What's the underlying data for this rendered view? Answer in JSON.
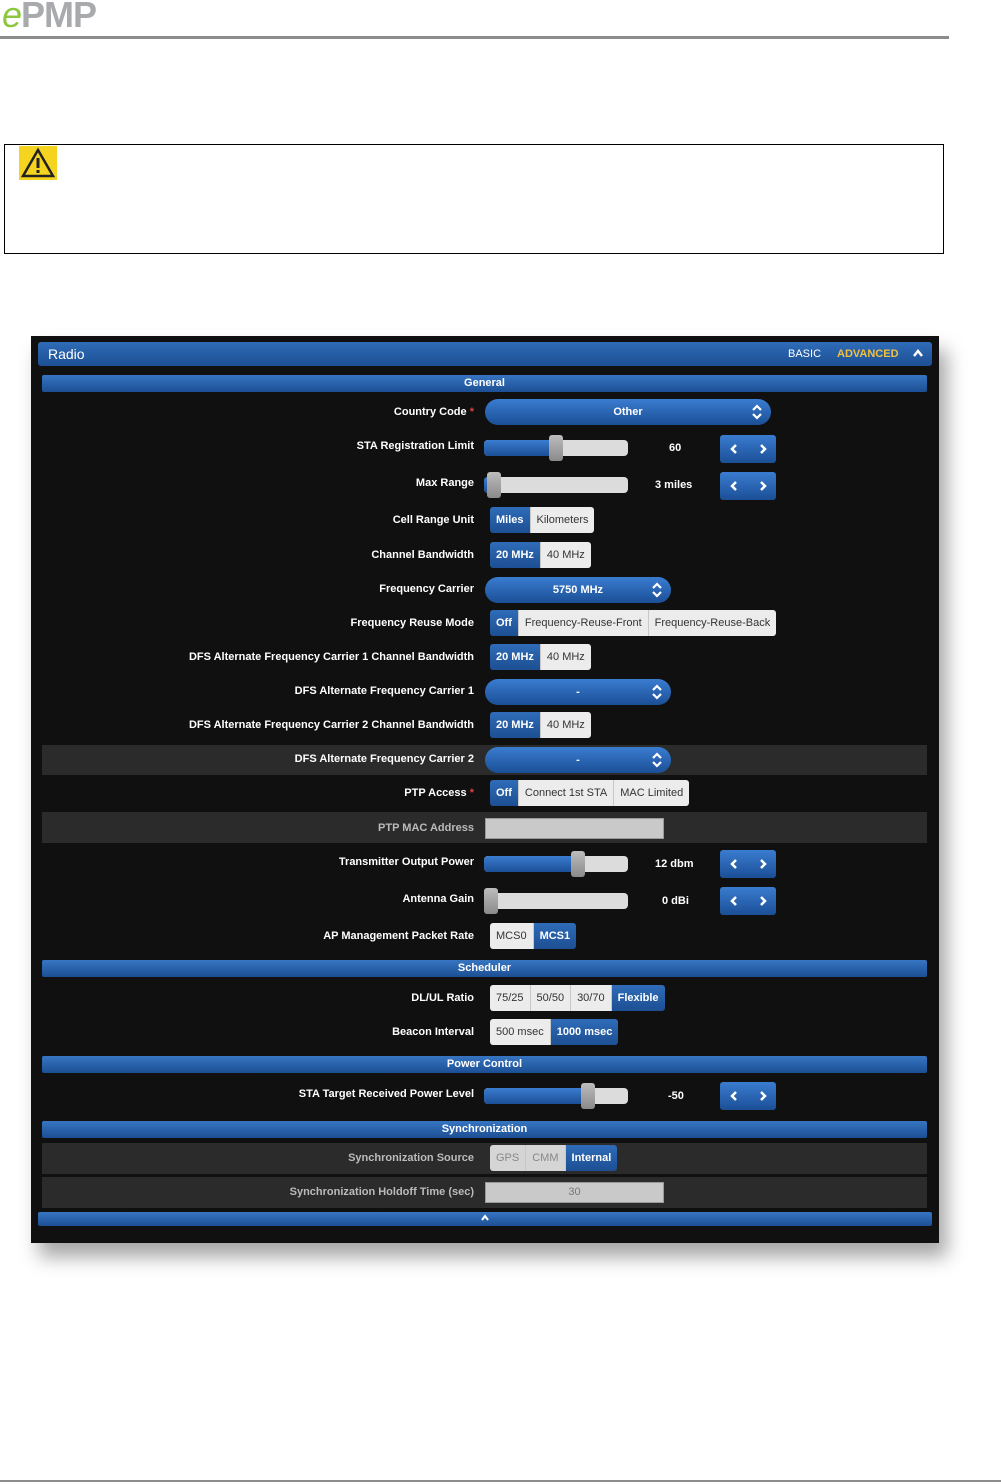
{
  "logo": {
    "prefix": "e",
    "name": "PMP"
  },
  "panel": {
    "title": "Radio",
    "mode_basic": "BASIC",
    "mode_advanced": "ADVANCED",
    "sections": {
      "general": "General",
      "scheduler": "Scheduler",
      "power": "Power Control",
      "sync": "Synchronization"
    },
    "country_code": {
      "label": "Country Code",
      "req": "*",
      "value": "Other"
    },
    "sta_limit": {
      "label": "STA Registration Limit",
      "value": "60",
      "level": 0.5
    },
    "max_range": {
      "label": "Max Range",
      "value": "3 miles",
      "level": 0.07
    },
    "cell_range_unit": {
      "label": "Cell Range Unit",
      "options": [
        "Miles",
        "Kilometers"
      ],
      "selected": "Miles"
    },
    "channel_bw": {
      "label": "Channel Bandwidth",
      "options": [
        "20 MHz",
        "40 MHz"
      ],
      "selected": "20 MHz"
    },
    "freq_carrier": {
      "label": "Frequency Carrier",
      "value": "5750 MHz"
    },
    "freq_reuse": {
      "label": "Frequency Reuse Mode",
      "options": [
        "Off",
        "Frequency-Reuse-Front",
        "Frequency-Reuse-Back"
      ],
      "selected": "Off"
    },
    "dfs1_bw": {
      "label": "DFS Alternate Frequency Carrier 1 Channel Bandwidth",
      "options": [
        "20 MHz",
        "40 MHz"
      ],
      "selected": "20 MHz"
    },
    "dfs1": {
      "label": "DFS Alternate Frequency Carrier 1",
      "value": "-"
    },
    "dfs2_bw": {
      "label": "DFS Alternate Frequency Carrier 2 Channel Bandwidth",
      "options": [
        "20 MHz",
        "40 MHz"
      ],
      "selected": "20 MHz"
    },
    "dfs2": {
      "label": "DFS Alternate Frequency Carrier 2",
      "value": "-"
    },
    "ptp_access": {
      "label": "PTP Access",
      "req": "*",
      "options": [
        "Off",
        "Connect 1st STA",
        "MAC Limited"
      ],
      "selected": "Off"
    },
    "ptp_mac": {
      "label": "PTP MAC Address",
      "value": ""
    },
    "tx_power": {
      "label": "Transmitter Output Power",
      "value": "12 dbm",
      "level": 0.65
    },
    "antenna_gain": {
      "label": "Antenna Gain",
      "value": "0 dBi",
      "level": 0.0
    },
    "ap_mgmt_rate": {
      "label": "AP Management Packet Rate",
      "options": [
        "MCS0",
        "MCS1"
      ],
      "selected": "MCS1"
    },
    "dlul": {
      "label": "DL/UL Ratio",
      "options": [
        "75/25",
        "50/50",
        "30/70",
        "Flexible"
      ],
      "selected": "Flexible"
    },
    "beacon": {
      "label": "Beacon Interval",
      "options": [
        "500 msec",
        "1000 msec"
      ],
      "selected": "1000 msec"
    },
    "sta_target": {
      "label": "STA Target Received Power Level",
      "value": "-50",
      "level": 0.72
    },
    "sync_source": {
      "label": "Synchronization Source",
      "options": [
        "GPS",
        "CMM",
        "Internal"
      ],
      "selected": "Internal"
    },
    "sync_holdoff": {
      "label": "Synchronization Holdoff Time (sec)",
      "value": "30"
    }
  },
  "colors": {
    "accent": "#1d4f93",
    "warning": "#f5d41f"
  },
  "icons": [
    "warning-icon",
    "chevron-up-icon",
    "chevron-left-icon",
    "chevron-right-icon",
    "select-arrows-icon"
  ]
}
